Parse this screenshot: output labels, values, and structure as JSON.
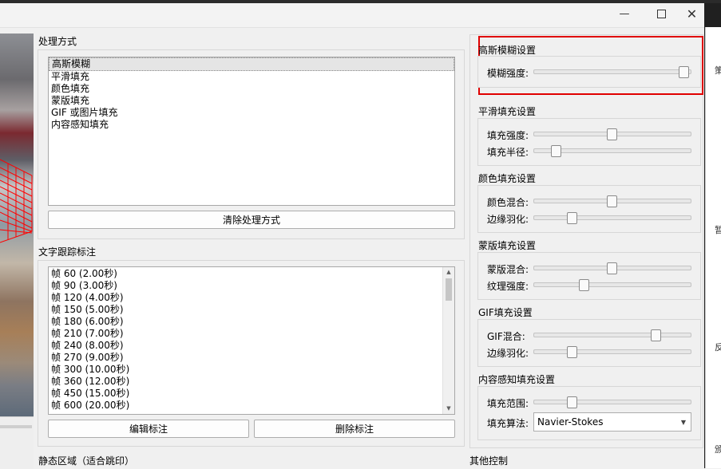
{
  "window": {
    "minimize_icon": "minimize-icon",
    "maximize_icon": "maximize-icon",
    "close_icon": "close-icon"
  },
  "processing": {
    "title": "处理方式",
    "items": [
      "高斯模糊",
      "平滑填充",
      "颜色填充",
      "蒙版填充",
      "GIF 或图片填充",
      "内容感知填充"
    ],
    "selected_index": 0,
    "clear_button": "清除处理方式"
  },
  "tracking": {
    "title": "文字跟踪标注",
    "items": [
      "帧 60 (2.00秒)",
      "帧 90 (3.00秒)",
      "帧 120 (4.00秒)",
      "帧 150 (5.00秒)",
      "帧 180 (6.00秒)",
      "帧 210 (7.00秒)",
      "帧 240 (8.00秒)",
      "帧 270 (9.00秒)",
      "帧 300 (10.00秒)",
      "帧 360 (12.00秒)",
      "帧 450 (15.00秒)",
      "帧 600 (20.00秒)"
    ],
    "edit_button": "编辑标注",
    "delete_button": "删除标注"
  },
  "static_area_title": "静态区域（适合跳印）",
  "other_controls_title": "其他控制",
  "settings": {
    "gaussian": {
      "title": "高斯模糊设置",
      "sliders": [
        {
          "label": "模糊强度:",
          "value": 0.99
        }
      ]
    },
    "smooth": {
      "title": "平滑填充设置",
      "sliders": [
        {
          "label": "填充强度:",
          "value": 0.5
        },
        {
          "label": "填充半径:",
          "value": 0.12
        }
      ]
    },
    "color": {
      "title": "颜色填充设置",
      "sliders": [
        {
          "label": "颜色混合:",
          "value": 0.5
        },
        {
          "label": "边缘羽化:",
          "value": 0.23
        }
      ]
    },
    "mask": {
      "title": "蒙版填充设置",
      "sliders": [
        {
          "label": "蒙版混合:",
          "value": 0.5
        },
        {
          "label": "纹理强度:",
          "value": 0.31
        }
      ]
    },
    "gif": {
      "title": "GIF填充设置",
      "sliders": [
        {
          "label": "GIF混合:",
          "value": 0.8
        },
        {
          "label": "边缘羽化:",
          "value": 0.23
        }
      ]
    },
    "content": {
      "title": "内容感知填充设置",
      "sliders": [
        {
          "label": "填充范围:",
          "value": 0.23
        }
      ],
      "algo_label": "填充算法:",
      "algo_value": "Navier-Stokes"
    }
  },
  "edge_text": [
    "策",
    "暂",
    "反",
    "颁"
  ]
}
